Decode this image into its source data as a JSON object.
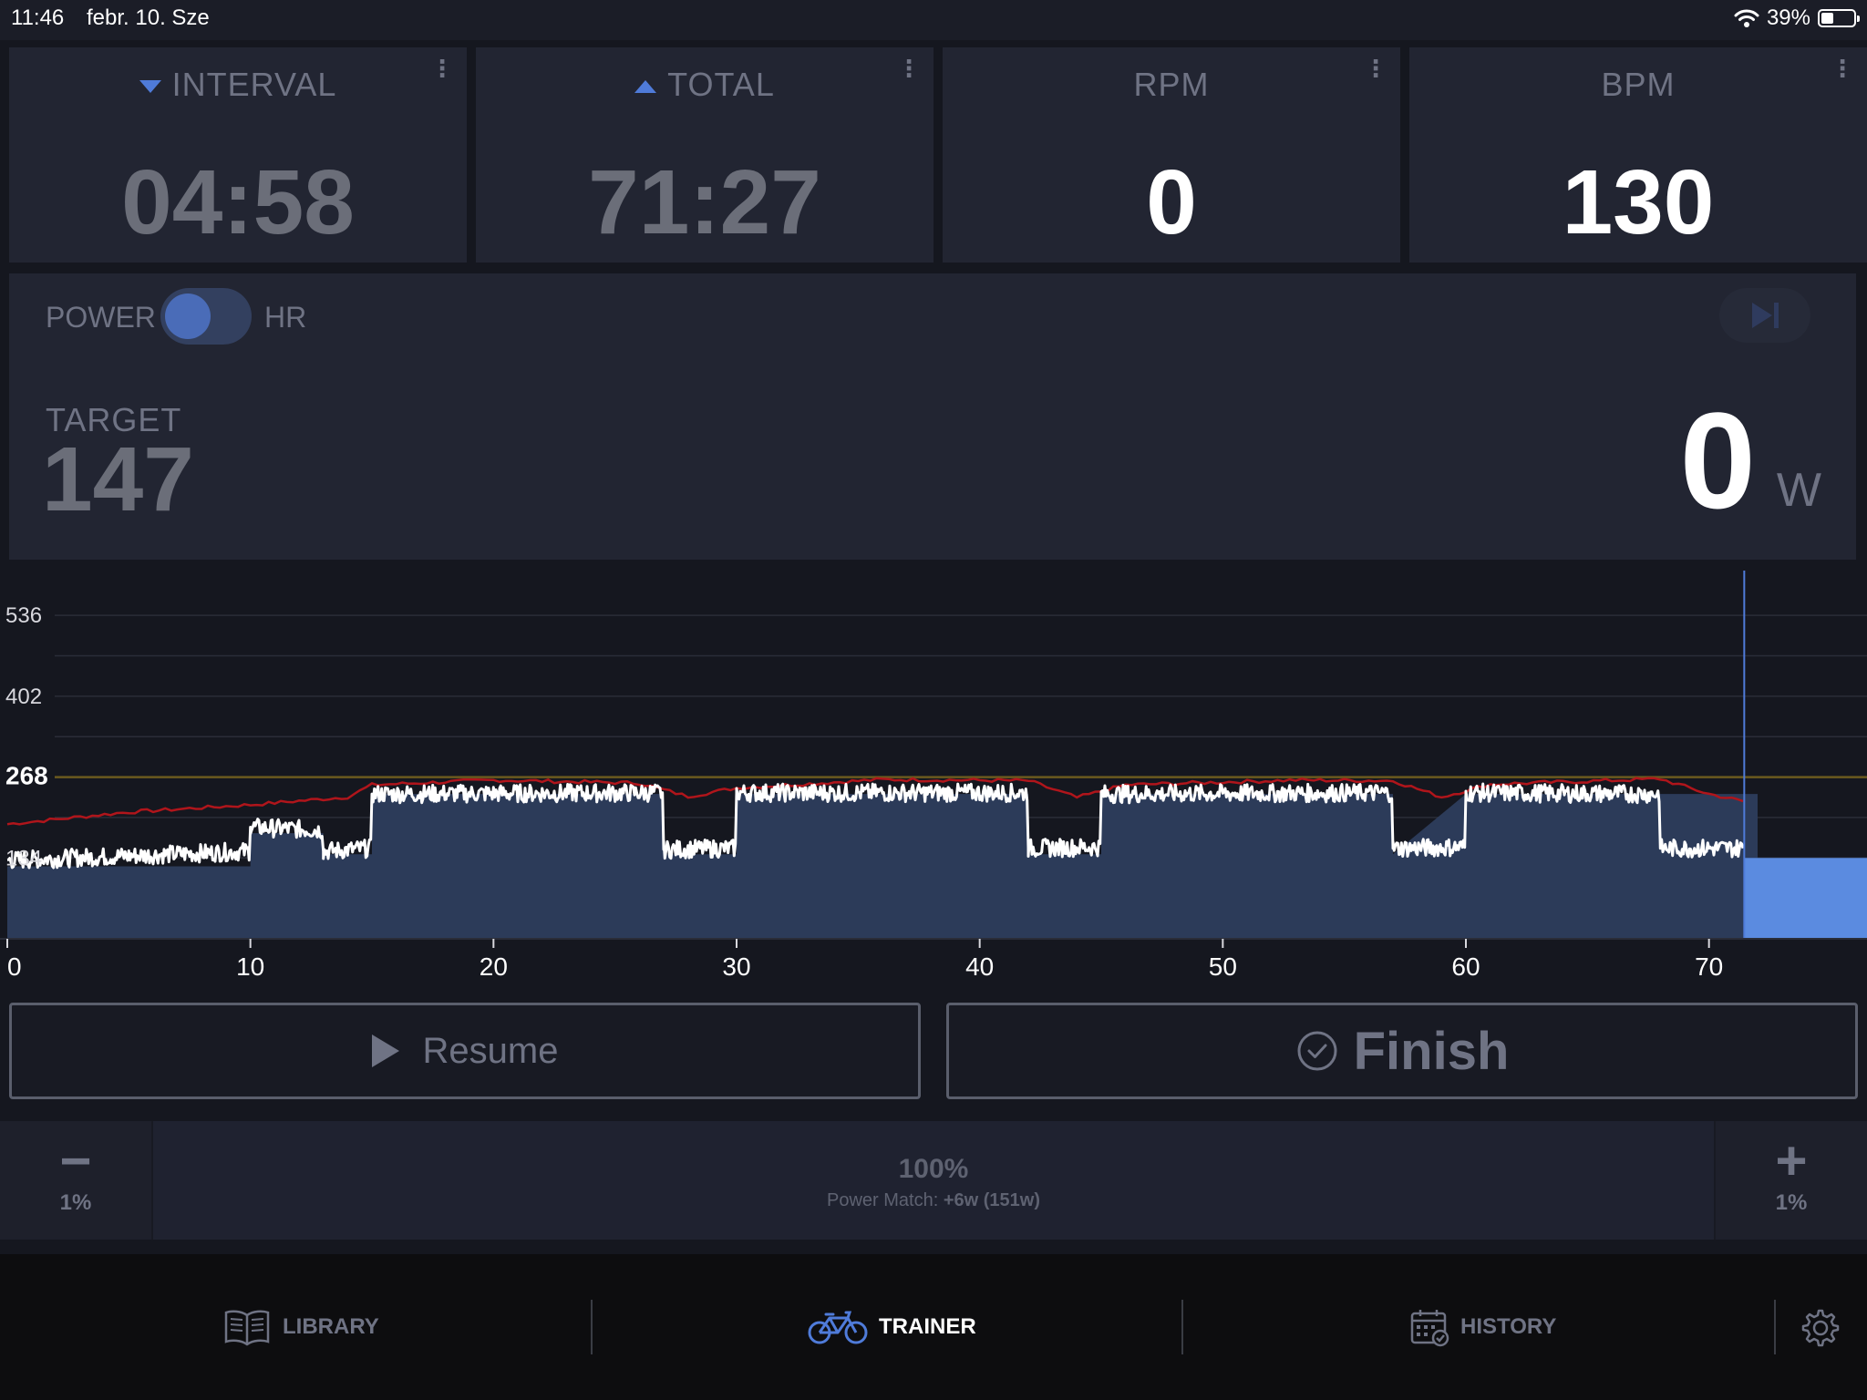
{
  "status_bar": {
    "time": "11:46",
    "date": "febr. 10. Sze",
    "battery": "39%",
    "battery_level": 0.39
  },
  "metrics": {
    "interval": {
      "label": "INTERVAL",
      "value": "04:58"
    },
    "total": {
      "label": "TOTAL",
      "value": "71:27"
    },
    "rpm": {
      "label": "RPM",
      "value": "0"
    },
    "bpm": {
      "label": "BPM",
      "value": "130"
    }
  },
  "power_panel": {
    "mode_power": "POWER",
    "mode_hr": "HR",
    "target_label": "TARGET",
    "target_value": "147",
    "power_value": "0",
    "power_unit": "W"
  },
  "chart_data": {
    "type": "area",
    "y_tick_labels": [
      "536",
      "402",
      "268",
      "134"
    ],
    "x_tick_labels": [
      "0",
      "10",
      "20",
      "30",
      "40",
      "50",
      "60",
      "70"
    ],
    "xlim": [
      0,
      76.5
    ],
    "ylim": [
      0,
      580
    ],
    "threshold_line": 268,
    "current_position": 71.45,
    "series": [
      {
        "kind": "target-area",
        "values": [
          [
            0,
            120
          ],
          [
            10,
            120
          ],
          [
            10,
            175
          ],
          [
            13,
            175
          ],
          [
            13,
            140
          ],
          [
            15,
            140
          ],
          [
            15,
            240
          ],
          [
            27,
            240
          ],
          [
            27,
            140
          ],
          [
            30,
            140
          ],
          [
            30,
            240
          ],
          [
            42,
            240
          ],
          [
            42,
            140
          ],
          [
            45,
            140
          ],
          [
            45,
            240
          ],
          [
            57,
            240
          ],
          [
            57,
            140
          ],
          [
            60,
            240
          ],
          [
            72,
            240
          ]
        ]
      },
      {
        "kind": "actual-power",
        "values": [
          [
            0,
            130
          ],
          [
            10,
            145
          ],
          [
            10,
            185
          ],
          [
            13,
            180
          ],
          [
            13,
            145
          ],
          [
            15,
            150
          ],
          [
            15,
            240
          ],
          [
            27,
            242
          ],
          [
            27,
            148
          ],
          [
            30,
            150
          ],
          [
            30,
            242
          ],
          [
            42,
            242
          ],
          [
            42,
            150
          ],
          [
            45,
            152
          ],
          [
            45,
            240
          ],
          [
            57,
            242
          ],
          [
            57,
            150
          ],
          [
            60,
            152
          ],
          [
            60,
            242
          ],
          [
            68,
            240
          ],
          [
            68,
            150
          ],
          [
            71.4,
            150
          ]
        ]
      },
      {
        "kind": "heart-rate",
        "values": [
          [
            0,
            190
          ],
          [
            5,
            210
          ],
          [
            10,
            222
          ],
          [
            14,
            235
          ],
          [
            15,
            255
          ],
          [
            20,
            263
          ],
          [
            26,
            258
          ],
          [
            28,
            236
          ],
          [
            30,
            250
          ],
          [
            36,
            264
          ],
          [
            42,
            262
          ],
          [
            44,
            234
          ],
          [
            46,
            255
          ],
          [
            53,
            263
          ],
          [
            57,
            262
          ],
          [
            59,
            235
          ],
          [
            61,
            256
          ],
          [
            68,
            265
          ],
          [
            70,
            240
          ],
          [
            71.4,
            228
          ]
        ]
      }
    ]
  },
  "actions": {
    "resume_label": "Resume",
    "finish_label": "Finish"
  },
  "adjust": {
    "decrease_sign": "−",
    "decrease_step": "1%",
    "increase_sign": "+",
    "increase_step": "1%",
    "percent": "100%",
    "power_match_label": "Power Match:",
    "power_match_value": "+6w (151w)"
  },
  "tabs": {
    "library": "LIBRARY",
    "trainer": "TRAINER",
    "history": "HISTORY"
  },
  "colors": {
    "accent": "#4f7bd9",
    "area_fill": "#2c3b59",
    "current_block": "#5b8be0",
    "threshold": "#6b5a1e",
    "heart_rate": "#b0151b"
  },
  "icons": {
    "library": "book-icon",
    "trainer": "bicycle-icon",
    "history": "calendar-check-icon",
    "settings": "gear-icon",
    "finish": "check-circle-icon",
    "resume": "play-icon",
    "skip": "skip-next-icon"
  }
}
